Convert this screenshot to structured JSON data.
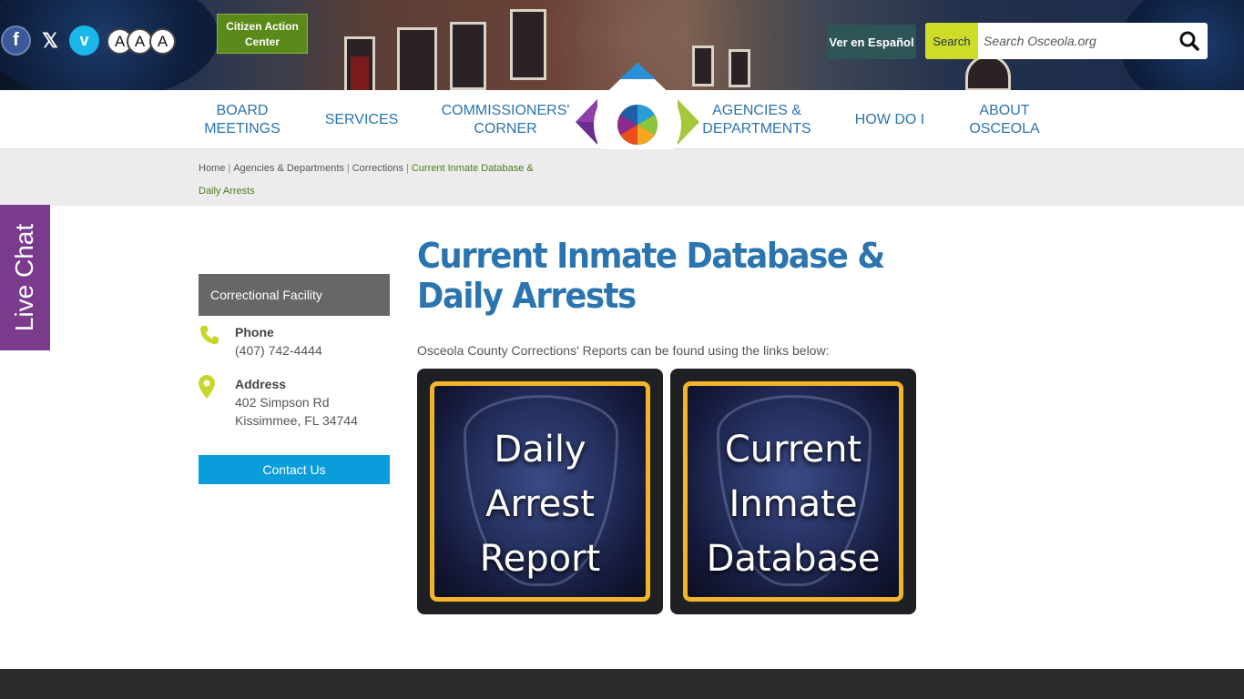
{
  "header": {
    "social": [
      "facebook-icon",
      "x-icon",
      "vimeo-icon"
    ],
    "font_sizes": [
      "A",
      "A",
      "A"
    ],
    "citizen_action": "Citizen Action Center",
    "espanol": "Ver en Español",
    "search_label": "Search",
    "search_placeholder": "Search Osceola.org"
  },
  "nav": {
    "items": [
      "BOARD\nMEETINGS",
      "SERVICES",
      "COMMISSIONERS'\nCORNER",
      "AGENCIES &\nDEPARTMENTS",
      "HOW DO I",
      "ABOUT\nOSCEOLA"
    ]
  },
  "breadcrumb": {
    "items": [
      "Home",
      "Agencies & Departments",
      "Corrections"
    ],
    "current": "Current Inmate Database & Daily Arrests"
  },
  "live_chat": "Live Chat",
  "sidebar": {
    "heading": "Correctional Facility",
    "phone_label": "Phone",
    "phone": "(407) 742-4444",
    "address_label": "Address",
    "address_line1": "402 Simpson Rd",
    "address_line2": "Kissimmee, FL 34744",
    "contact_button": "Contact Us"
  },
  "main": {
    "title": "Current Inmate Database & Daily Arrests",
    "intro": "Osceola County Corrections' Reports can be found using the links below:",
    "cards": [
      {
        "text": "Daily\nArrest\nReport"
      },
      {
        "text": "Current\nInmate\nDatabase"
      }
    ]
  },
  "colors": {
    "brand_blue": "#2a74b0",
    "accent_green": "#cddc29",
    "live_chat": "#7a3b8d",
    "contact_button": "#0a9ddb"
  }
}
